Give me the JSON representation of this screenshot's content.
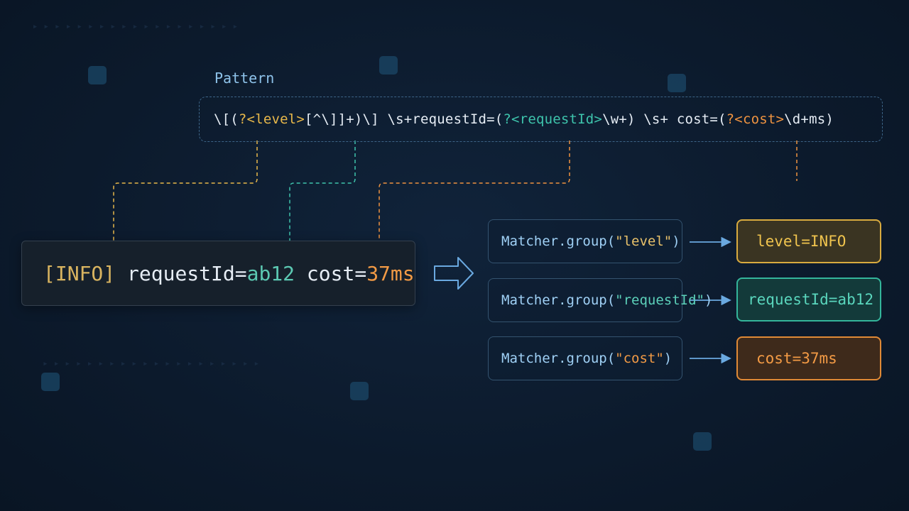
{
  "pattern": {
    "label": "Pattern",
    "tokens": {
      "t1": "\\[(",
      "t2": "?<level>",
      "t3": "[^\\]]+)",
      "t4": "\\]",
      "t5": " \\s+requestId=(",
      "t6": "?<requestId>",
      "t7": "\\w+) \\s+ cost=(",
      "t8": "?<cost>",
      "t9": "\\d+ms)"
    }
  },
  "log_line": {
    "level": "[INFO]",
    "req_key": " requestId=",
    "req_val": "ab12",
    "cost_key": " cost=",
    "cost_val": "37ms"
  },
  "matchers": [
    {
      "prefix": "Matcher.group(",
      "arg": "\"level\"",
      "suffix": ")"
    },
    {
      "prefix": "Matcher.group(",
      "arg": "\"requestId\"",
      "suffix": ")"
    },
    {
      "prefix": "Matcher.group(",
      "arg": "\"cost\"",
      "suffix": ")"
    }
  ],
  "results": [
    {
      "text": "level=INFO"
    },
    {
      "text": "requestId=ab12"
    },
    {
      "text": "cost=37ms"
    }
  ],
  "colors": {
    "level": "#e8b84a",
    "requestId": "#3ec4ac",
    "cost": "#ef9340",
    "arrow": "#6aa9e0",
    "background": "#0d1c2f"
  }
}
